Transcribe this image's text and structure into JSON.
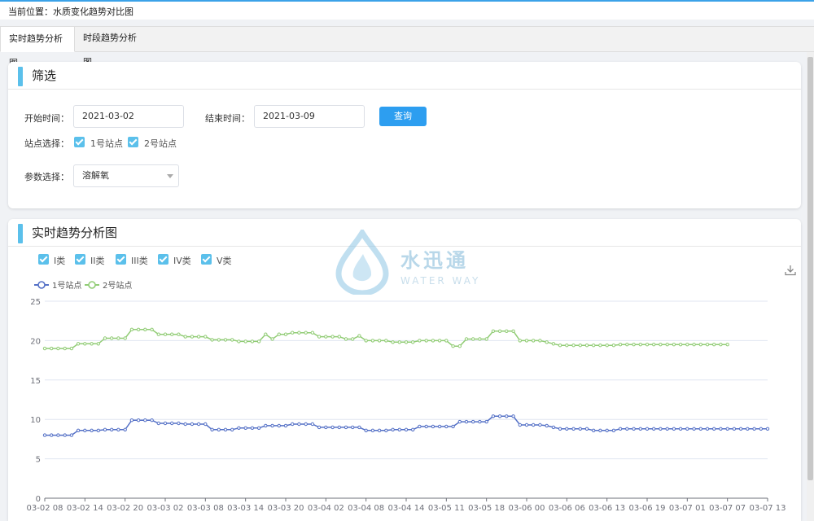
{
  "breadcrumb": "当前位置：水质变化趋势对比图",
  "tabs": [
    {
      "label": "实时趋势分析图",
      "active": true
    },
    {
      "label": "时段趋势分析图",
      "active": false
    }
  ],
  "filter": {
    "title": "筛选",
    "start_label": "开始时间：",
    "start_value": "2021-03-02",
    "end_label": "结束时间：",
    "end_value": "2021-03-09",
    "query_label": "查询",
    "station_label": "站点选择：",
    "stations": [
      {
        "label": "1号站点",
        "checked": true
      },
      {
        "label": "2号站点",
        "checked": true
      }
    ],
    "param_label": "参数选择：",
    "param_value": "溶解氧"
  },
  "chart_panel": {
    "title": "实时趋势分析图",
    "classes": [
      {
        "label": "I类",
        "checked": true
      },
      {
        "label": "II类",
        "checked": true
      },
      {
        "label": "III类",
        "checked": true
      },
      {
        "label": "IV类",
        "checked": true
      },
      {
        "label": "V类",
        "checked": true
      }
    ],
    "download_icon": "download-icon"
  },
  "watermark": {
    "cn": "水迅通",
    "en": "WATER WAY"
  },
  "colors": {
    "accent": "#2d9ef0",
    "bar": "#5bc0eb",
    "series1": "#5470c6",
    "series2": "#91cc75"
  },
  "chart_data": {
    "type": "line",
    "title": "",
    "xlabel": "",
    "ylabel": "",
    "ylim": [
      0,
      25
    ],
    "yticks": [
      0,
      5,
      10,
      15,
      20,
      25
    ],
    "grid": true,
    "legend": "top-left",
    "x_tick_labels": [
      "03-02 08",
      "03-02 14",
      "03-02 20",
      "03-03 02",
      "03-03 08",
      "03-03 14",
      "03-03 20",
      "03-04 02",
      "03-04 08",
      "03-04 14",
      "03-05 11",
      "03-05 18",
      "03-06 00",
      "03-06 06",
      "03-06 13",
      "03-06 19",
      "03-07 01",
      "03-07 07",
      "03-07 13"
    ],
    "series": [
      {
        "name": "1号站点",
        "color": "#5470c6",
        "values": [
          8.0,
          8.0,
          8.0,
          8.0,
          8.0,
          8.6,
          8.6,
          8.6,
          8.6,
          8.7,
          8.7,
          8.7,
          8.7,
          9.9,
          9.9,
          9.9,
          9.9,
          9.5,
          9.5,
          9.5,
          9.5,
          9.4,
          9.4,
          9.4,
          9.4,
          8.7,
          8.7,
          8.7,
          8.7,
          8.9,
          8.9,
          8.9,
          8.9,
          9.2,
          9.2,
          9.2,
          9.2,
          9.4,
          9.4,
          9.4,
          9.4,
          9.0,
          9.0,
          9.0,
          9.0,
          9.0,
          9.0,
          9.0,
          8.6,
          8.6,
          8.6,
          8.6,
          8.7,
          8.7,
          8.7,
          8.7,
          9.1,
          9.1,
          9.1,
          9.1,
          9.1,
          9.1,
          9.7,
          9.7,
          9.7,
          9.7,
          9.7,
          10.4,
          10.4,
          10.4,
          10.4,
          9.3,
          9.3,
          9.3,
          9.3,
          9.2,
          9.0,
          8.8,
          8.8,
          8.8,
          8.8,
          8.8,
          8.6,
          8.6,
          8.6,
          8.6,
          8.8,
          8.8,
          8.8,
          8.8,
          8.8,
          8.8,
          8.8,
          8.8,
          8.8,
          8.8,
          8.8,
          8.8,
          8.8,
          8.8,
          8.8,
          8.8,
          8.8,
          8.8,
          8.8,
          8.8,
          8.8,
          8.8,
          8.8
        ]
      },
      {
        "name": "2号站点",
        "color": "#91cc75",
        "values": [
          19.0,
          19.0,
          19.0,
          19.0,
          19.0,
          19.6,
          19.6,
          19.6,
          19.6,
          20.3,
          20.3,
          20.3,
          20.3,
          21.4,
          21.4,
          21.4,
          21.4,
          20.8,
          20.8,
          20.8,
          20.8,
          20.5,
          20.5,
          20.5,
          20.5,
          20.1,
          20.1,
          20.1,
          20.1,
          19.9,
          19.9,
          19.9,
          19.9,
          20.8,
          20.2,
          20.8,
          20.8,
          21.0,
          21.0,
          21.0,
          21.0,
          20.5,
          20.5,
          20.5,
          20.5,
          20.2,
          20.2,
          20.6,
          20.0,
          20.0,
          20.0,
          20.0,
          19.8,
          19.8,
          19.8,
          19.8,
          20.0,
          20.0,
          20.0,
          20.0,
          20.0,
          19.3,
          19.3,
          20.2,
          20.2,
          20.2,
          20.2,
          21.2,
          21.2,
          21.2,
          21.2,
          20.0,
          20.0,
          20.0,
          20.0,
          19.8,
          19.6,
          19.4,
          19.4,
          19.4,
          19.4,
          19.4,
          19.4,
          19.4,
          19.4,
          19.4,
          19.5,
          19.5,
          19.5,
          19.5,
          19.5,
          19.5,
          19.5,
          19.5,
          19.5,
          19.5,
          19.5,
          19.5,
          19.5,
          19.5,
          19.5,
          19.5,
          19.5
        ]
      }
    ]
  }
}
